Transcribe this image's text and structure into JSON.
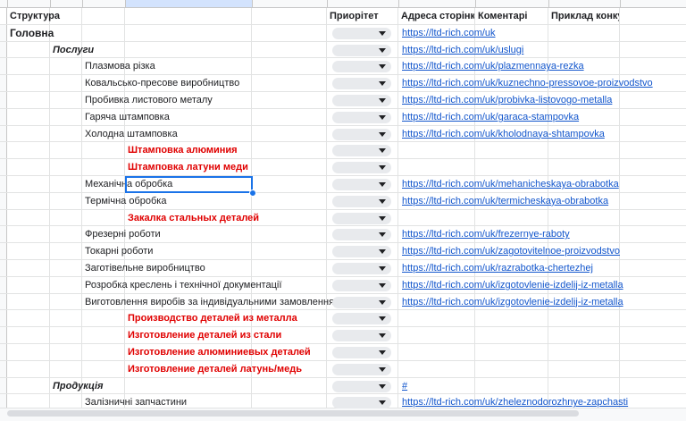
{
  "header": {
    "structure": "Структура",
    "priority": "Приорітет",
    "address": "Адреса сторінки",
    "comments": "Коментарі",
    "example": "Приклад конкурентів"
  },
  "rows": [
    {
      "level": 0,
      "text": "Головна",
      "style": "bold big",
      "dropdown": true,
      "url": "https://ltd-rich.com/uk"
    },
    {
      "level": 1,
      "text": "Послуги",
      "style": "italic",
      "dropdown": true,
      "url": "https://ltd-rich.com/uk/uslugi"
    },
    {
      "level": 2,
      "text": "Плазмова різка",
      "style": "",
      "dropdown": true,
      "url": "https://ltd-rich.com/uk/plazmennaya-rezka"
    },
    {
      "level": 2,
      "text": "Ковальсько-пресове виробництво",
      "style": "",
      "dropdown": true,
      "url": "https://ltd-rich.com/uk/kuznechno-pressovoe-proizvodstvo"
    },
    {
      "level": 2,
      "text": "Пробивка листового металу",
      "style": "",
      "dropdown": true,
      "url": "https://ltd-rich.com/uk/probivka-listovogo-metalla"
    },
    {
      "level": 2,
      "text": "Гаряча штамповка",
      "style": "",
      "dropdown": true,
      "url": "https://ltd-rich.com/uk/garaca-stampovka"
    },
    {
      "level": 2,
      "text": "Холодна штамповка",
      "style": "",
      "dropdown": true,
      "url": "https://ltd-rich.com/uk/kholodnaya-shtampovka"
    },
    {
      "level": 3,
      "text": "Штамповка алюминия",
      "style": "red",
      "dropdown": true,
      "url": ""
    },
    {
      "level": 3,
      "text": "Штамповка латуни меди",
      "style": "red",
      "dropdown": true,
      "url": ""
    },
    {
      "level": 2,
      "text": "Механічна обробка",
      "style": "",
      "dropdown": true,
      "url": "https://ltd-rich.com/uk/mehanicheskaya-obrabotka",
      "selected": true
    },
    {
      "level": 2,
      "text": "Термічна обробка",
      "style": "",
      "dropdown": true,
      "url": "https://ltd-rich.com/uk/termicheskaya-obrabotka"
    },
    {
      "level": 3,
      "text": "Закалка стальных деталей",
      "style": "red",
      "dropdown": true,
      "url": ""
    },
    {
      "level": 2,
      "text": "Фрезерні роботи",
      "style": "",
      "dropdown": true,
      "url": "https://ltd-rich.com/uk/frezernye-raboty"
    },
    {
      "level": 2,
      "text": "Токарні роботи",
      "style": "",
      "dropdown": true,
      "url": "https://ltd-rich.com/uk/zagotovitelnoe-proizvodstvo"
    },
    {
      "level": 2,
      "text": "Заготівельне виробництво",
      "style": "",
      "dropdown": true,
      "url": "https://ltd-rich.com/uk/razrabotka-chertezhej"
    },
    {
      "level": 2,
      "text": "Розробка креслень і технічної документації",
      "style": "",
      "dropdown": true,
      "url": "https://ltd-rich.com/uk/izgotovlenie-izdelij-iz-metalla"
    },
    {
      "level": 2,
      "text": "Виготовлення виробів за індивідуальними замовленнями",
      "style": "",
      "dropdown": true,
      "url": "https://ltd-rich.com/uk/izgotovlenie-izdelij-iz-metalla"
    },
    {
      "level": 3,
      "text": "Производство деталей из металла",
      "style": "red",
      "dropdown": true,
      "url": ""
    },
    {
      "level": 3,
      "text": "Изготовление деталей из стали",
      "style": "red",
      "dropdown": true,
      "url": ""
    },
    {
      "level": 3,
      "text": "Изготовление алюминиевых деталей",
      "style": "red",
      "dropdown": true,
      "url": ""
    },
    {
      "level": 3,
      "text": "Изготовление деталей латунь/медь",
      "style": "red",
      "dropdown": true,
      "url": ""
    },
    {
      "level": 1,
      "text": "Продукція",
      "style": "italic",
      "dropdown": true,
      "url": "#"
    },
    {
      "level": 2,
      "text": "Залізничні запчастини",
      "style": "",
      "dropdown": true,
      "url": "https://ltd-rich.com/uk/zheleznodorozhnye-zapchasti"
    }
  ]
}
